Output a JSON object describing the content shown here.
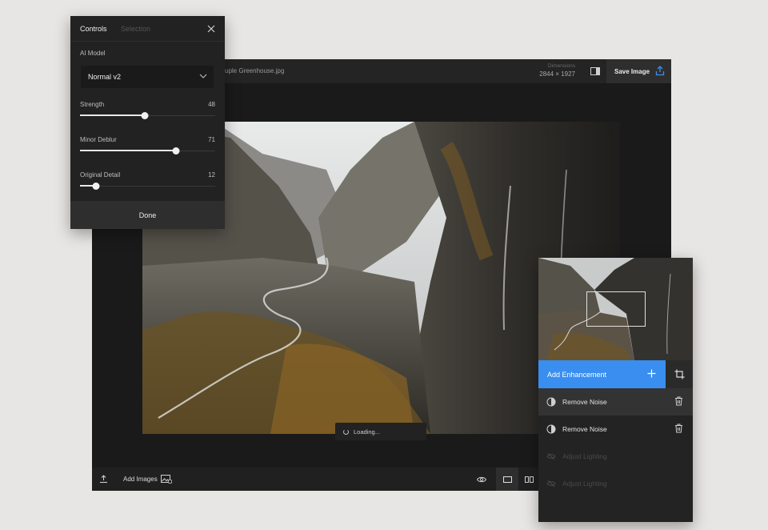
{
  "controls": {
    "tabs": [
      "Controls",
      "Selection"
    ],
    "ai_model_label": "AI Model",
    "ai_model_value": "Normal v2",
    "sliders": [
      {
        "label": "Strength",
        "value": "48",
        "fraction": 0.48
      },
      {
        "label": "Minor Deblur",
        "value": "71",
        "fraction": 0.71
      },
      {
        "label": "Original Detail",
        "value": "12",
        "fraction": 0.12
      }
    ],
    "done_label": "Done"
  },
  "header": {
    "filename": "uple Greenhouse.jpg",
    "dimensions_label": "Dimensions",
    "dimensions_value": "2844 × 1927",
    "save_label": "Save Image"
  },
  "canvas": {
    "loading_text": "Loading..."
  },
  "bottom": {
    "add_images_label": "Add Images"
  },
  "enhancements": {
    "add_label": "Add Enhancement",
    "items": [
      {
        "label": "Remove Noise",
        "active": true,
        "enabled": true
      },
      {
        "label": "Remove Noise",
        "active": false,
        "enabled": true
      },
      {
        "label": "Adjust Lighting",
        "active": false,
        "enabled": false
      },
      {
        "label": "Adjust Lighting",
        "active": false,
        "enabled": false
      }
    ]
  },
  "colors": {
    "accent": "#3a8ef0",
    "panel_bg": "#222222",
    "page_bg": "#e8e6e4"
  },
  "icons": [
    "close-icon",
    "chevron-down-icon",
    "compare-icon",
    "upload-icon",
    "tray-upload-icon",
    "image-add-icon",
    "eye-icon",
    "single-view-icon",
    "split-view-icon",
    "plus-icon",
    "crop-icon",
    "noise-icon",
    "eye-off-icon",
    "trash-icon",
    "spinner-icon"
  ]
}
